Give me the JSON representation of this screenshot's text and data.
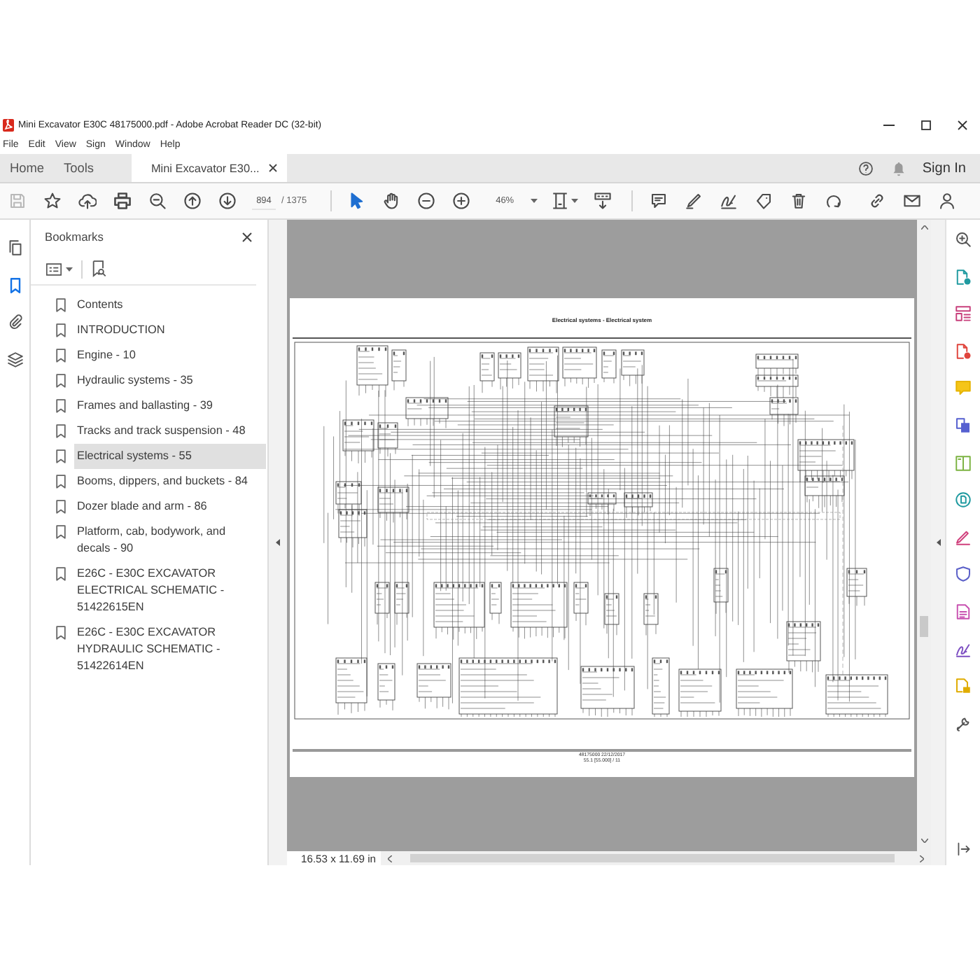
{
  "window": {
    "title": "Mini Excavator E30C 48175000.pdf - Adobe Acrobat Reader DC (32-bit)"
  },
  "menu": [
    "File",
    "Edit",
    "View",
    "Sign",
    "Window",
    "Help"
  ],
  "tabs": [
    {
      "label": "Home",
      "kind": "view",
      "selected": false
    },
    {
      "label": "Tools",
      "kind": "view",
      "selected": false
    },
    {
      "label": "Mini Excavator E30...",
      "kind": "document",
      "selected": true
    }
  ],
  "account": {
    "sign_in": "Sign In"
  },
  "toolbar": {
    "page_number": "894",
    "page_count": "/ 1375",
    "zoom": "46%"
  },
  "nav_panels": [
    {
      "kind": "pages",
      "selected": false
    },
    {
      "kind": "bookmarks",
      "selected": true
    },
    {
      "kind": "attachments",
      "selected": false
    },
    {
      "kind": "layers",
      "selected": false
    }
  ],
  "bookmarks": {
    "title": "Bookmarks",
    "items": [
      {
        "label": "Contents",
        "selected": false
      },
      {
        "label": "INTRODUCTION",
        "selected": false
      },
      {
        "label": "Engine - 10",
        "selected": false
      },
      {
        "label": "Hydraulic systems - 35",
        "selected": false
      },
      {
        "label": "Frames and ballasting - 39",
        "selected": false
      },
      {
        "label": "Tracks and track suspension - 48",
        "selected": false
      },
      {
        "label": "Electrical systems - 55",
        "selected": true
      },
      {
        "label": "Booms, dippers, and buckets - 84",
        "selected": false
      },
      {
        "label": "Dozer blade and arm - 86",
        "selected": false
      },
      {
        "label": "Platform, cab, bodywork, and decals - 90",
        "selected": false
      },
      {
        "label": "E26C - E30C EXCAVATOR ELECTRICAL SCHEMATIC - 51422615EN",
        "selected": false
      },
      {
        "label": "E26C - E30C EXCAVATOR HYDRAULIC SCHEMATIC - 51422614EN",
        "selected": false
      }
    ]
  },
  "document": {
    "page_title": "Electrical systems - Electrical system",
    "footer": [
      "48175000 22/12/2017",
      "55.1 [55.000] / 11"
    ]
  },
  "status_bar": {
    "page_size": "16.53 x 11.69 in"
  }
}
